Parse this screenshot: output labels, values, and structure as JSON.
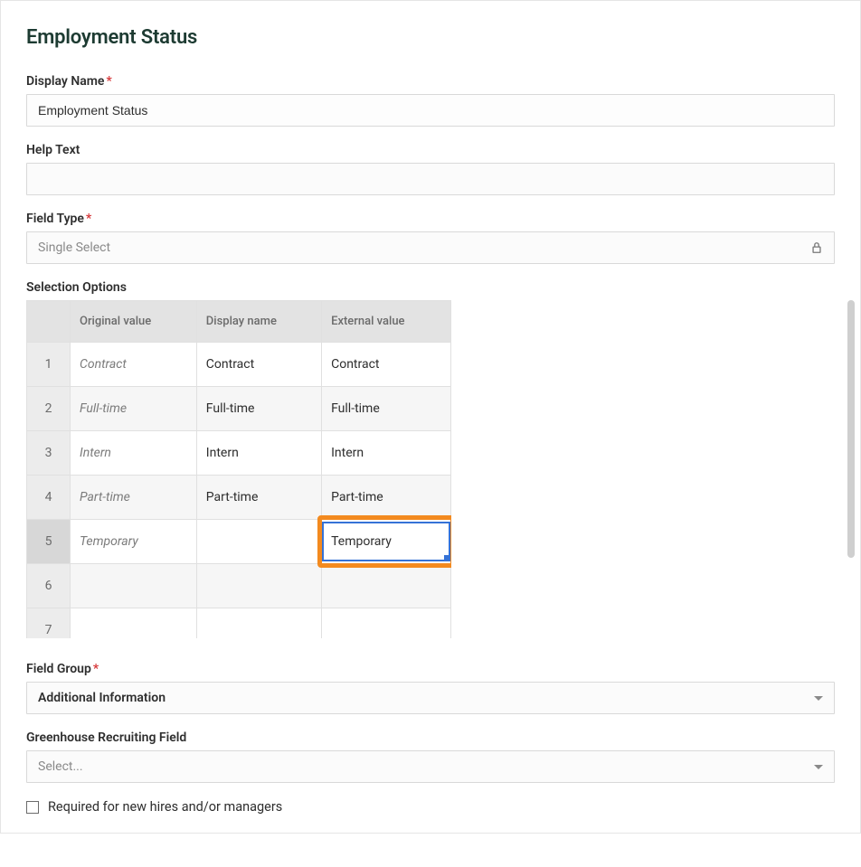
{
  "title": "Employment Status",
  "fields": {
    "display_name": {
      "label": "Display Name",
      "value": "Employment Status"
    },
    "help_text": {
      "label": "Help Text",
      "value": ""
    },
    "field_type": {
      "label": "Field Type",
      "value": "Single Select"
    },
    "selection_options": {
      "label": "Selection Options",
      "headers": {
        "original": "Original value",
        "display": "Display name",
        "external": "External value"
      },
      "rows": [
        {
          "n": "1",
          "original": "Contract",
          "display": "Contract",
          "external": "Contract"
        },
        {
          "n": "2",
          "original": "Full-time",
          "display": "Full-time",
          "external": "Full-time"
        },
        {
          "n": "3",
          "original": "Intern",
          "display": "Intern",
          "external": "Intern"
        },
        {
          "n": "4",
          "original": "Part-time",
          "display": "Part-time",
          "external": "Part-time"
        },
        {
          "n": "5",
          "original": "Temporary",
          "display": "",
          "external": "Temporary"
        },
        {
          "n": "6",
          "original": "",
          "display": "",
          "external": ""
        },
        {
          "n": "7",
          "original": "",
          "display": "",
          "external": ""
        }
      ]
    },
    "field_group": {
      "label": "Field Group",
      "value": "Additional Information"
    },
    "recruiting_field": {
      "label": "Greenhouse Recruiting Field",
      "placeholder": "Select..."
    },
    "required_checkbox": {
      "label": "Required for new hires and/or managers",
      "checked": false
    }
  }
}
